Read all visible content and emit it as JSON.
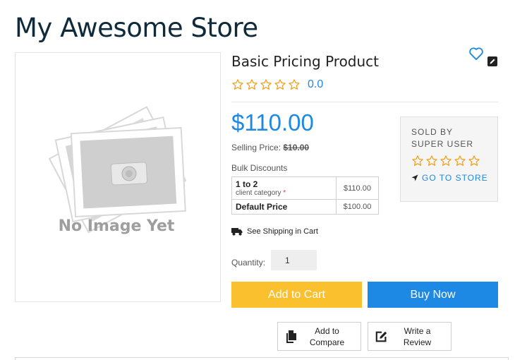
{
  "store": {
    "title": "My Awesome Store"
  },
  "image": {
    "placeholder_text": "No Image Yet"
  },
  "product": {
    "name": "Basic Pricing Product",
    "rating_value": "0.0",
    "rating_stars": 0,
    "price": "$110.00",
    "selling_price_label": "Selling Price:",
    "selling_price_value": "$10.00"
  },
  "bulk": {
    "label": "Bulk Discounts",
    "rows": [
      {
        "qty": "1 to 2",
        "sub": "client category",
        "req": "*",
        "value": "$110.00"
      },
      {
        "qty": "Default Price",
        "value": "$100.00"
      }
    ]
  },
  "shipping": {
    "text": "See Shipping in Cart"
  },
  "quantity": {
    "label": "Quantity:",
    "value": "1"
  },
  "buttons": {
    "add_to_cart": "Add to Cart",
    "buy_now": "Buy Now",
    "add_to_compare_line1": "Add to",
    "add_to_compare_line2": "Compare",
    "write_review_line1": "Write a",
    "write_review_line2": "Review"
  },
  "seller": {
    "sold_by": "SOLD BY",
    "name": "SUPER USER",
    "rating_stars": 0,
    "go_to_store": "GO TO STORE"
  },
  "colors": {
    "accent_blue": "#1e88e5",
    "cart_yellow": "#fbc02d",
    "star_orange": "#f39c12",
    "title_navy": "#0f2a3b"
  },
  "icons": {
    "wishlist": "heart-icon",
    "edit": "edit-icon",
    "star": "star-outline-icon",
    "truck": "truck-icon",
    "navigate": "location-arrow-icon",
    "compare": "copy-icon",
    "review": "pencil-square-icon"
  }
}
